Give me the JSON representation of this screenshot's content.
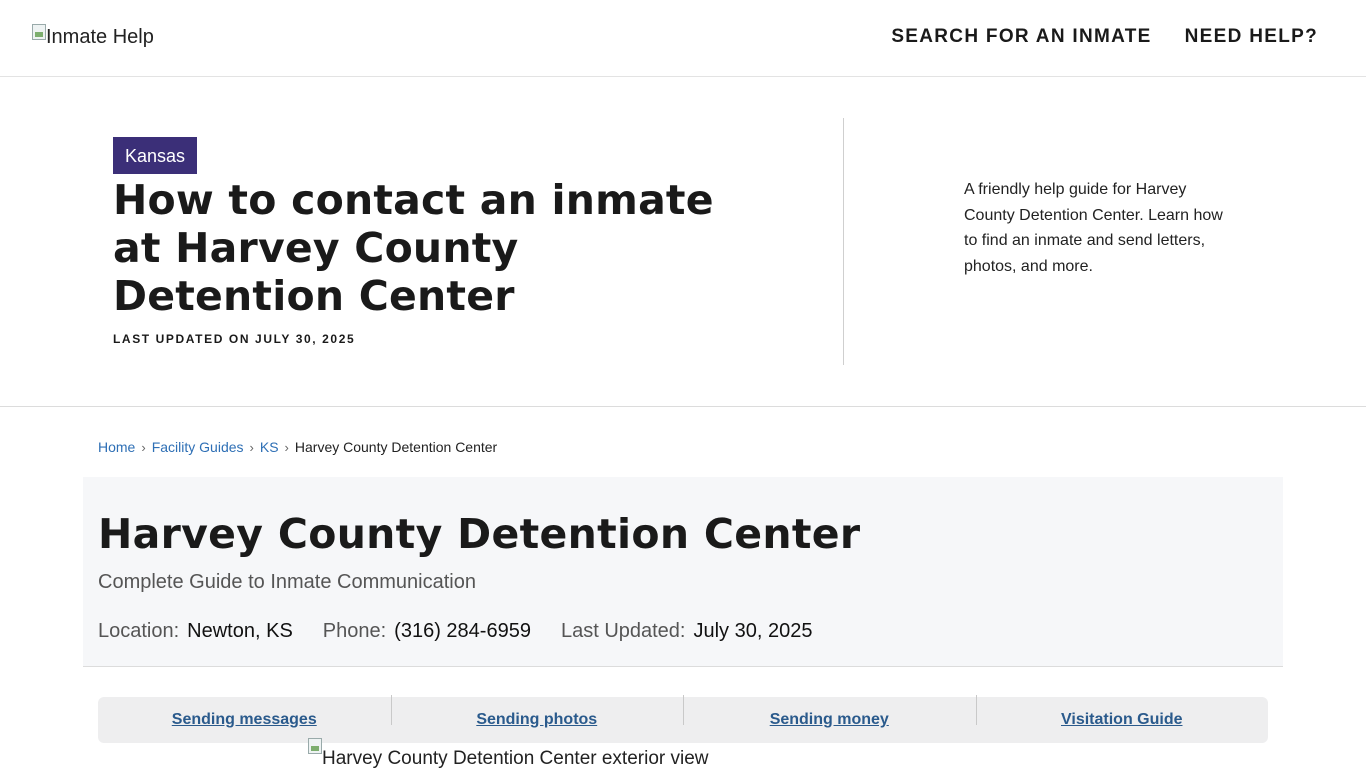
{
  "header": {
    "logo_alt": "Inmate Help",
    "nav": [
      "SEARCH FOR AN INMATE",
      "NEED HELP?"
    ]
  },
  "hero": {
    "state_badge": "Kansas",
    "title": "How to contact an inmate at Harvey County Detention Center",
    "last_updated": "LAST UPDATED ON JULY 30, 2025",
    "description": "A friendly help guide for Harvey County Detention Center. Learn how to find an inmate and send letters, photos, and more."
  },
  "breadcrumb": {
    "items": [
      "Home",
      "Facility Guides",
      "KS"
    ],
    "current": "Harvey County Detention Center",
    "separator": "›"
  },
  "facility": {
    "title": "Harvey County Detention Center",
    "subtitle": "Complete Guide to Inmate Communication",
    "location_label": "Location:",
    "location_value": "Newton, KS",
    "phone_label": "Phone:",
    "phone_value": "(316) 284-6959",
    "updated_label": "Last Updated:",
    "updated_value": "July 30, 2025"
  },
  "guide_tabs": [
    "Sending messages",
    "Sending photos",
    "Sending money",
    "Visitation Guide"
  ],
  "exterior_image_alt": "Harvey County Detention Center exterior view",
  "colors": {
    "badge_bg": "#3b2f78",
    "link": "#2e6fb5",
    "tab_link": "#2a5a8c",
    "card_bg": "#f6f7f9"
  }
}
